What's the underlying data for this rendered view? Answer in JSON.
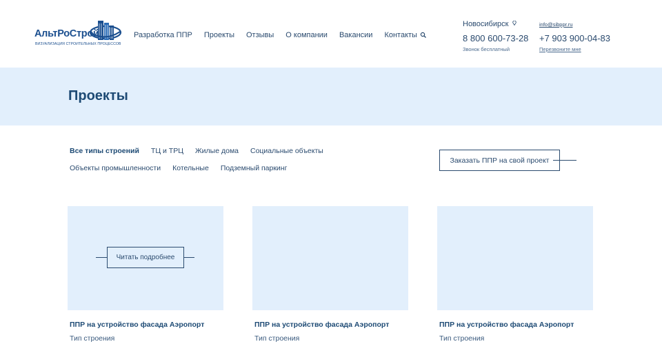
{
  "logo": {
    "name": "АльтРоСтрой",
    "tagline": "ВИЗУАЛИЗАЦИЯ СТРОИТЕЛЬНЫХ ПРОЦЕССОВ",
    "color": "#1b4f8f"
  },
  "nav": {
    "items": [
      "Разработка ППР",
      "Проекты",
      "Отзывы",
      "О компании",
      "Вакансии",
      "Контакты"
    ],
    "search_icon": "search-icon"
  },
  "contacts": {
    "city": "Новосибирск",
    "phone_main": "8 800 600-73-28",
    "phone_main_note": "Звонок бесплатный",
    "email": "info@sibppr.ru",
    "phone_second": "+7 903 900-04-83",
    "callback": "Перезвоните мне"
  },
  "banner": {
    "title": "Проекты",
    "background": "#e2effc"
  },
  "filters": {
    "row1": [
      "Все типы строений",
      "ТЦ и ТРЦ",
      "Жилые дома",
      "Социальные объекты"
    ],
    "row2": [
      "Объекты промышленности",
      "Котельные",
      "Подземный паркинг"
    ],
    "active": "Все типы строений"
  },
  "order_button": "Заказать ППР на свой проект",
  "cards": [
    {
      "title": "ППР на устройство фасада Аэропорт",
      "type": "Тип строения",
      "read_more": "Читать подробнее"
    },
    {
      "title": "ППР на устройство фасада Аэропорт",
      "type": "Тип строения"
    },
    {
      "title": "ППР на устройство фасада Аэропорт",
      "type": "Тип строения"
    }
  ]
}
